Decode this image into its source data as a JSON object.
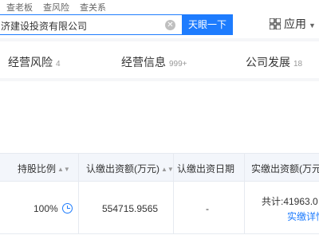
{
  "quick_tabs": [
    "查老板",
    "查风险",
    "查关系"
  ],
  "search": {
    "value": "济建设投资有限公司",
    "button_label": "天眼一下"
  },
  "apps": {
    "label": "应用"
  },
  "nav_tabs": [
    {
      "label": "经营风险",
      "count": "4"
    },
    {
      "label": "经营信息",
      "count": "999+"
    },
    {
      "label": "公司发展",
      "count": "18"
    }
  ],
  "table": {
    "headers": [
      "持股比例",
      "认缴出资额(万元)",
      "认缴出资日期",
      "实缴出资额(万元"
    ],
    "row": {
      "ratio": "100%",
      "subscribed_amount": "554715.9565",
      "subscribed_date": "-",
      "paid_total": "共计:41963.0",
      "paid_detail_link": "实缴详情"
    }
  },
  "colors": {
    "accent": "#1e7cfe",
    "header_bg": "#f3f6fb",
    "page_bg": "#f5f6f8"
  }
}
